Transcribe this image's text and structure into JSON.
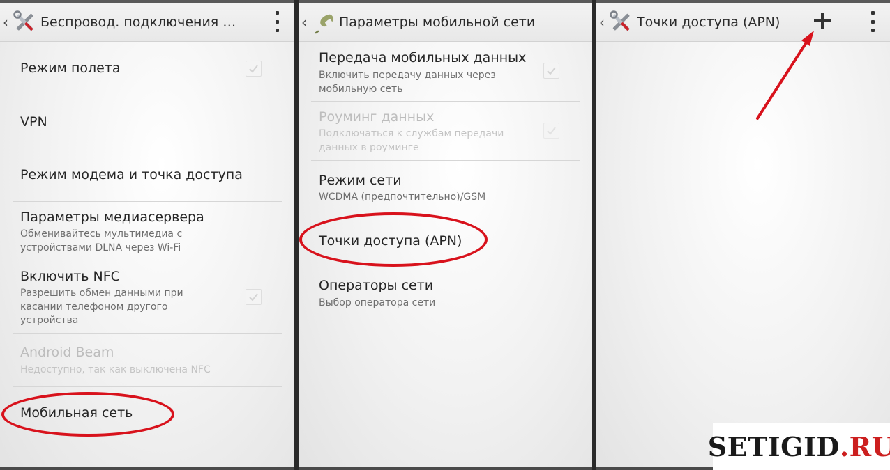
{
  "colors": {
    "accent_red": "#d8121c",
    "watermark_red": "#cc1f1f"
  },
  "panel1": {
    "back_icon": "chevron-left-icon",
    "app_icon": "tools-icon",
    "title": "Беспровод. подключения и...",
    "items": [
      {
        "title": "Режим полета",
        "checked": true
      },
      {
        "title": "VPN"
      },
      {
        "title": "Режим модема и точка доступа"
      },
      {
        "title": "Параметры медиасервера",
        "subtitle": "Обменивайтесь мультимедиа с устройствами DLNA через Wi-Fi"
      },
      {
        "title": "Включить NFC",
        "subtitle": "Разрешить обмен данными при касании телефоном другого устройства",
        "checked": true
      },
      {
        "title": "Android Beam",
        "subtitle": "Недоступно, так как выключена NFC",
        "disabled": true
      },
      {
        "title": "Мобильная сеть",
        "highlighted": true
      }
    ]
  },
  "panel2": {
    "back_icon": "chevron-left-icon",
    "app_icon": "phone-handset-icon",
    "title": "Параметры мобильной сети",
    "items": [
      {
        "title": "Передача мобильных данных",
        "subtitle": "Включить передачу данных через мобильную сеть",
        "checked": true
      },
      {
        "title": "Роуминг данных",
        "subtitle": "Подключаться к службам передачи данных в роуминге",
        "checked": true,
        "disabled": true
      },
      {
        "title": "Режим сети",
        "subtitle": "WCDMA (предпочтительно)/GSM"
      },
      {
        "title": "Точки доступа (APN)",
        "highlighted": true
      },
      {
        "title": "Операторы сети",
        "subtitle": "Выбор оператора сети"
      }
    ]
  },
  "panel3": {
    "back_icon": "chevron-left-icon",
    "app_icon": "tools-icon",
    "title": "Точки доступа (APN)",
    "add_icon": "plus-icon",
    "menu_icon": "overflow-menu-icon",
    "annotation": "red-arrow-icon"
  },
  "watermark": {
    "main": "SETIGID",
    "dot": ".",
    "tld": "RU"
  }
}
